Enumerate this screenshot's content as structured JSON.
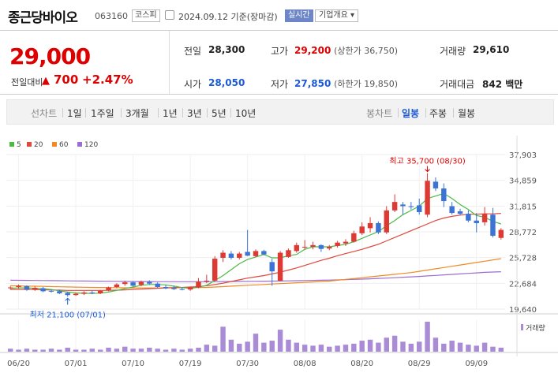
{
  "header": {
    "stock_name": "종근당바이오",
    "stock_code": "063160",
    "market_badge": "코스피",
    "date_info": "2024.09.12 기준(장마감)",
    "realtime_badge": "실시간",
    "company_button": "기업개요 ▾"
  },
  "price": {
    "current": "29,000",
    "change_label": "전일대비",
    "change_arrow": "▲",
    "change_value": "700",
    "change_pct": "+2.47%"
  },
  "stats": {
    "prev_label": "전일",
    "prev_value": "28,300",
    "high_label": "고가",
    "high_value": "29,200",
    "high_limit": "(상한가 36,750)",
    "volume_label": "거래량",
    "volume_value": "29,610",
    "open_label": "시가",
    "open_value": "28,050",
    "low_label": "저가",
    "low_value": "27,850",
    "low_limit": "(하한가 19,850)",
    "amount_label": "거래대금",
    "amount_value": "842 백만"
  },
  "periods": {
    "line_label": "선차트",
    "items": [
      "1일",
      "1주일",
      "3개월",
      "1년",
      "3년",
      "5년",
      "10년"
    ],
    "candle_label": "봉차트",
    "candle_items": [
      "일봉",
      "주봉",
      "월봉"
    ],
    "active_candle": "일봉"
  },
  "colors": {
    "up": "#dd3a33",
    "down": "#3c74d6",
    "ma5": "#4cb944",
    "ma20": "#e0483b",
    "ma60": "#f08a24",
    "ma120": "#9b6dd0",
    "volume": "#a98bd6"
  },
  "chart_data": {
    "type": "candlestick",
    "legend": [
      {
        "name": "5",
        "color": "#4cb944"
      },
      {
        "name": "20",
        "color": "#e0483b"
      },
      {
        "name": "60",
        "color": "#f08a24"
      },
      {
        "name": "120",
        "color": "#9b6dd0"
      }
    ],
    "y_ticks": [
      "37,903",
      "34,859",
      "31,815",
      "28,772",
      "25,728",
      "22,684",
      "19,640"
    ],
    "ylim": [
      19640,
      37903
    ],
    "x_ticks": [
      {
        "i": 1,
        "label": "06/20"
      },
      {
        "i": 8,
        "label": "07/01"
      },
      {
        "i": 15,
        "label": "07/10"
      },
      {
        "i": 22,
        "label": "07/19"
      },
      {
        "i": 29,
        "label": "07/30"
      },
      {
        "i": 36,
        "label": "08/08"
      },
      {
        "i": 43,
        "label": "08/20"
      },
      {
        "i": 50,
        "label": "08/29"
      },
      {
        "i": 57,
        "label": "09/09"
      }
    ],
    "annotations": {
      "high": "최고 35,700 (08/30)",
      "low": "최저 21,100 (07/01)"
    },
    "volume_label": "거래량",
    "candles": [
      {
        "o": 22150,
        "h": 22350,
        "l": 21950,
        "c": 22200
      },
      {
        "o": 22250,
        "h": 22550,
        "l": 22050,
        "c": 22400
      },
      {
        "o": 22350,
        "h": 22450,
        "l": 21800,
        "c": 21950
      },
      {
        "o": 21950,
        "h": 22300,
        "l": 21800,
        "c": 22150
      },
      {
        "o": 22100,
        "h": 22250,
        "l": 21650,
        "c": 21750
      },
      {
        "o": 21800,
        "h": 22000,
        "l": 21600,
        "c": 21700
      },
      {
        "o": 21750,
        "h": 21950,
        "l": 21400,
        "c": 21500
      },
      {
        "o": 21550,
        "h": 21700,
        "l": 21100,
        "c": 21300
      },
      {
        "o": 21300,
        "h": 21600,
        "l": 21200,
        "c": 21450
      },
      {
        "o": 21450,
        "h": 21750,
        "l": 21300,
        "c": 21600
      },
      {
        "o": 21600,
        "h": 21800,
        "l": 21400,
        "c": 21500
      },
      {
        "o": 21500,
        "h": 21900,
        "l": 21400,
        "c": 21800
      },
      {
        "o": 21850,
        "h": 22300,
        "l": 21750,
        "c": 22200
      },
      {
        "o": 22250,
        "h": 22700,
        "l": 22100,
        "c": 22550
      },
      {
        "o": 22600,
        "h": 23000,
        "l": 22400,
        "c": 22800
      },
      {
        "o": 22800,
        "h": 22950,
        "l": 22300,
        "c": 22400
      },
      {
        "o": 22500,
        "h": 23000,
        "l": 22350,
        "c": 22850
      },
      {
        "o": 22850,
        "h": 23050,
        "l": 22500,
        "c": 22650
      },
      {
        "o": 22650,
        "h": 22800,
        "l": 22100,
        "c": 22250
      },
      {
        "o": 22250,
        "h": 22500,
        "l": 22000,
        "c": 22100
      },
      {
        "o": 22150,
        "h": 22400,
        "l": 21900,
        "c": 22000
      },
      {
        "o": 22000,
        "h": 22200,
        "l": 21850,
        "c": 21950
      },
      {
        "o": 21950,
        "h": 22300,
        "l": 21800,
        "c": 22200
      },
      {
        "o": 22200,
        "h": 23300,
        "l": 22100,
        "c": 22900
      },
      {
        "o": 22900,
        "h": 23700,
        "l": 22700,
        "c": 23000
      },
      {
        "o": 23000,
        "h": 25900,
        "l": 22900,
        "c": 25600
      },
      {
        "o": 25700,
        "h": 26600,
        "l": 25200,
        "c": 26300
      },
      {
        "o": 26200,
        "h": 26500,
        "l": 25500,
        "c": 25700
      },
      {
        "o": 25700,
        "h": 26400,
        "l": 25500,
        "c": 26200
      },
      {
        "o": 26400,
        "h": 29000,
        "l": 25900,
        "c": 25950
      },
      {
        "o": 25900,
        "h": 26700,
        "l": 25800,
        "c": 26500
      },
      {
        "o": 26500,
        "h": 26650,
        "l": 26000,
        "c": 26100
      },
      {
        "o": 25200,
        "h": 25600,
        "l": 22400,
        "c": 24100
      },
      {
        "o": 23000,
        "h": 26500,
        "l": 22900,
        "c": 26300
      },
      {
        "o": 25800,
        "h": 26800,
        "l": 25700,
        "c": 26600
      },
      {
        "o": 26500,
        "h": 27500,
        "l": 26300,
        "c": 27200
      },
      {
        "o": 27000,
        "h": 27800,
        "l": 26700,
        "c": 27000
      },
      {
        "o": 27000,
        "h": 27600,
        "l": 26700,
        "c": 27200
      },
      {
        "o": 27200,
        "h": 27300,
        "l": 26400,
        "c": 26750
      },
      {
        "o": 26800,
        "h": 27200,
        "l": 26600,
        "c": 27000
      },
      {
        "o": 27100,
        "h": 27700,
        "l": 26900,
        "c": 27500
      },
      {
        "o": 27400,
        "h": 27900,
        "l": 27100,
        "c": 27600
      },
      {
        "o": 27600,
        "h": 28900,
        "l": 27500,
        "c": 28600
      },
      {
        "o": 28600,
        "h": 29900,
        "l": 28400,
        "c": 29400
      },
      {
        "o": 29200,
        "h": 30500,
        "l": 28700,
        "c": 29800
      },
      {
        "o": 29800,
        "h": 30000,
        "l": 28500,
        "c": 28700
      },
      {
        "o": 28700,
        "h": 31800,
        "l": 28500,
        "c": 31300
      },
      {
        "o": 31300,
        "h": 33200,
        "l": 31100,
        "c": 32300
      },
      {
        "o": 32000,
        "h": 32300,
        "l": 30800,
        "c": 31800
      },
      {
        "o": 31800,
        "h": 32300,
        "l": 31400,
        "c": 31700
      },
      {
        "o": 31900,
        "h": 32700,
        "l": 30800,
        "c": 31100
      },
      {
        "o": 30800,
        "h": 35700,
        "l": 30500,
        "c": 34800
      },
      {
        "o": 34700,
        "h": 35200,
        "l": 33600,
        "c": 33900
      },
      {
        "o": 33900,
        "h": 34500,
        "l": 31700,
        "c": 32400
      },
      {
        "o": 31800,
        "h": 32300,
        "l": 30800,
        "c": 31000
      },
      {
        "o": 31200,
        "h": 31500,
        "l": 30700,
        "c": 30900
      },
      {
        "o": 30900,
        "h": 31300,
        "l": 29900,
        "c": 30100
      },
      {
        "o": 30100,
        "h": 31000,
        "l": 28700,
        "c": 29800
      },
      {
        "o": 29900,
        "h": 31700,
        "l": 29500,
        "c": 30900
      },
      {
        "o": 30800,
        "h": 31600,
        "l": 28100,
        "c": 28300
      },
      {
        "o": 28050,
        "h": 29200,
        "l": 27850,
        "c": 29000
      }
    ],
    "ma5": [
      22100,
      22150,
      22150,
      22100,
      22050,
      21950,
      21800,
      21650,
      21550,
      21500,
      21500,
      21520,
      21650,
      21850,
      22050,
      22250,
      22450,
      22550,
      22550,
      22500,
      22350,
      22180,
      22080,
      22220,
      22450,
      23000,
      23600,
      24300,
      25000,
      25500,
      25800,
      26100,
      25700,
      25700,
      25950,
      26100,
      26700,
      27000,
      27000,
      27000,
      27150,
      27300,
      27600,
      28000,
      28400,
      28800,
      29500,
      30100,
      30800,
      31300,
      31800,
      32700,
      33000,
      33300,
      32700,
      32000,
      31400,
      30700,
      30500,
      30000,
      29700
    ],
    "ma20": [
      21950,
      21950,
      21950,
      21950,
      21900,
      21900,
      21880,
      21850,
      21850,
      21850,
      21850,
      21850,
      21860,
      21880,
      21900,
      21950,
      22000,
      22050,
      22100,
      22150,
      22180,
      22200,
      22250,
      22300,
      22400,
      22550,
      22700,
      22900,
      23100,
      23300,
      23450,
      23600,
      23800,
      24000,
      24250,
      24500,
      24800,
      25100,
      25400,
      25650,
      25950,
      26200,
      26450,
      26700,
      27000,
      27300,
      27700,
      28100,
      28500,
      28900,
      29300,
      29700,
      30100,
      30400,
      30600,
      30750,
      30850,
      30850,
      30900,
      30900,
      30950
    ],
    "ma60": [
      22400,
      22380,
      22360,
      22340,
      22320,
      22300,
      22280,
      22260,
      22240,
      22220,
      22200,
      22190,
      22180,
      22170,
      22160,
      22150,
      22140,
      22140,
      22140,
      22150,
      22160,
      22170,
      22180,
      22190,
      22200,
      22250,
      22300,
      22350,
      22400,
      22450,
      22500,
      22550,
      22600,
      22650,
      22700,
      22750,
      22800,
      22850,
      22900,
      22950,
      23050,
      23150,
      23250,
      23350,
      23450,
      23550,
      23650,
      23750,
      23850,
      23950,
      24100,
      24250,
      24400,
      24550,
      24700,
      24850,
      25000,
      25150,
      25300,
      25450,
      25600
    ],
    "ma120": [
      23050,
      23040,
      23030,
      23020,
      23010,
      23000,
      22990,
      22980,
      22970,
      22960,
      22950,
      22940,
      22930,
      22920,
      22910,
      22900,
      22895,
      22890,
      22885,
      22880,
      22875,
      22870,
      22870,
      22870,
      22875,
      22880,
      22890,
      22900,
      22910,
      22920,
      22930,
      22940,
      22950,
      22960,
      22975,
      22990,
      23010,
      23030,
      23050,
      23070,
      23090,
      23120,
      23150,
      23180,
      23220,
      23260,
      23300,
      23350,
      23400,
      23450,
      23500,
      23560,
      23620,
      23680,
      23740,
      23800,
      23860,
      23920,
      23980,
      24020,
      24060
    ],
    "volume": [
      3,
      2,
      3,
      2,
      2,
      3,
      2,
      4,
      2,
      2,
      3,
      2,
      4,
      3,
      5,
      3,
      3,
      4,
      3,
      2,
      3,
      2,
      3,
      4,
      7,
      6,
      25,
      12,
      8,
      10,
      18,
      9,
      11,
      22,
      12,
      9,
      7,
      6,
      7,
      5,
      6,
      7,
      8,
      11,
      12,
      9,
      14,
      16,
      10,
      8,
      10,
      30,
      14,
      8,
      11,
      9,
      7,
      6,
      9,
      5,
      4
    ]
  }
}
